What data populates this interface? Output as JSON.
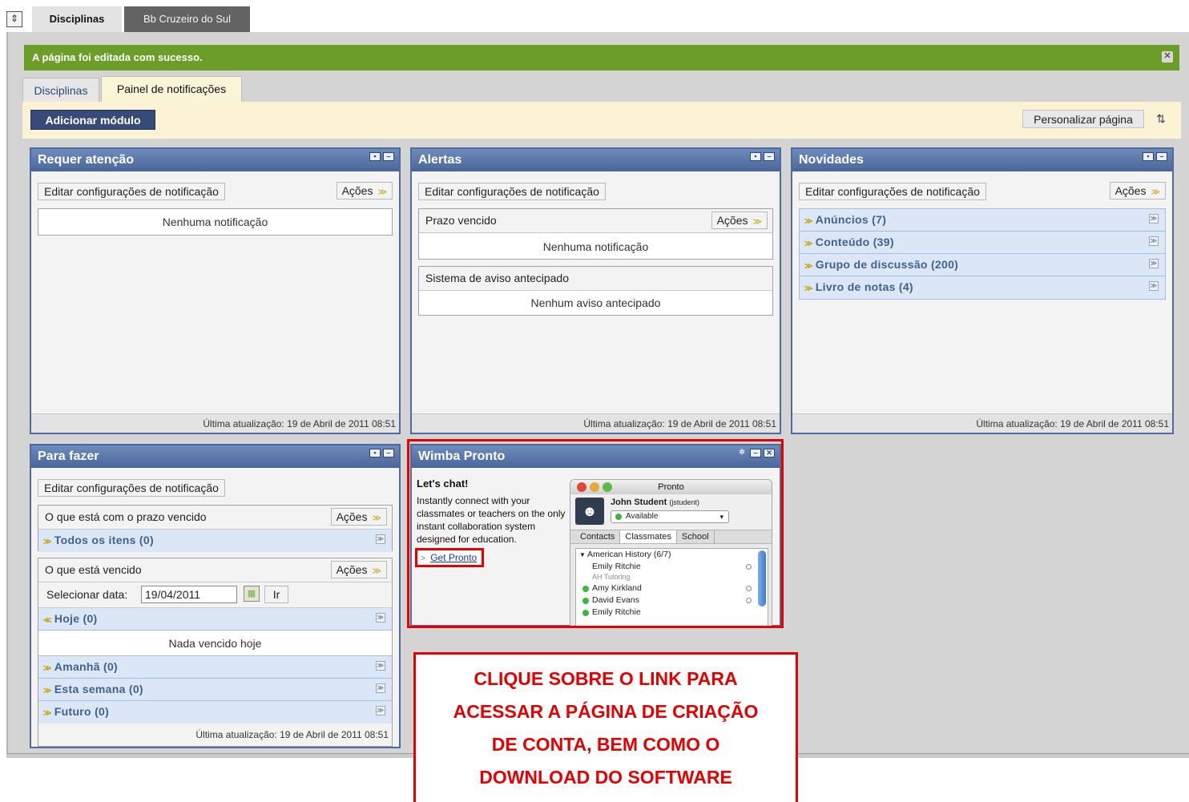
{
  "top_tabs": {
    "active": "Disciplinas",
    "inactive": "Bb Cruzeiro do Sul"
  },
  "success_message": "A página foi editada com sucesso.",
  "sub_tabs": {
    "tab1": "Disciplinas",
    "tab2": "Painel de notificações"
  },
  "toolbar": {
    "add_module": "Adicionar módulo",
    "personalize": "Personalizar página"
  },
  "common": {
    "edit_config": "Editar configurações de notificação",
    "actions": "Ações",
    "last_update": "Última atualização: 19 de Abril de 2011 08:51"
  },
  "requer_atencao": {
    "title": "Requer atenção",
    "empty": "Nenhuma notificação"
  },
  "alertas": {
    "title": "Alertas",
    "section1_title": "Prazo vencido",
    "section1_empty": "Nenhuma notificação",
    "section2_title": "Sistema de aviso antecipado",
    "section2_empty": "Nenhum aviso antecipado"
  },
  "novidades": {
    "title": "Novidades",
    "items": [
      "Anúncios (7)",
      "Conteúdo (39)",
      "Grupo de discussão (200)",
      "Livro de notas (4)"
    ]
  },
  "para_fazer": {
    "title": "Para fazer",
    "overdue_title": "O que está com o prazo vencido",
    "all_items": "Todos os itens (0)",
    "due_title": "O que está vencido",
    "select_date_label": "Selecionar data:",
    "date_value": "19/04/2011",
    "go_button": "Ir",
    "today": "Hoje (0)",
    "nothing_today": "Nada vencido hoje",
    "tomorrow": "Amanhã (0)",
    "this_week": "Esta semana (0)",
    "future": "Futuro (0)"
  },
  "wimba": {
    "title": "Wimba Pronto",
    "heading": "Let's chat!",
    "text": "Instantly connect with your classmates or teachers on the only instant collaboration system designed for education.",
    "link": "Get Pronto",
    "mock": {
      "window_title": "Pronto",
      "user_name": "John Student",
      "user_handle": "(jstudent)",
      "status": "Available",
      "tabs": [
        "Contacts",
        "Classmates",
        "School"
      ],
      "group": "American History (6/7)",
      "contacts": [
        "Emily Ritchie",
        "AH Tutoring",
        "Amy Kirkland",
        "David Evans",
        "Emily Ritchie"
      ]
    }
  },
  "callout": {
    "line1": "CLIQUE SOBRE O LINK PARA",
    "line2": "ACESSAR A PÁGINA DE CRIAÇÃO",
    "line3": "DE CONTA, BEM COMO O",
    "line4": "DOWNLOAD DO SOFTWARE"
  },
  "colors": {
    "header_blue": "#4a6698",
    "success_green": "#6b9d28",
    "callout_red": "#e60000"
  }
}
